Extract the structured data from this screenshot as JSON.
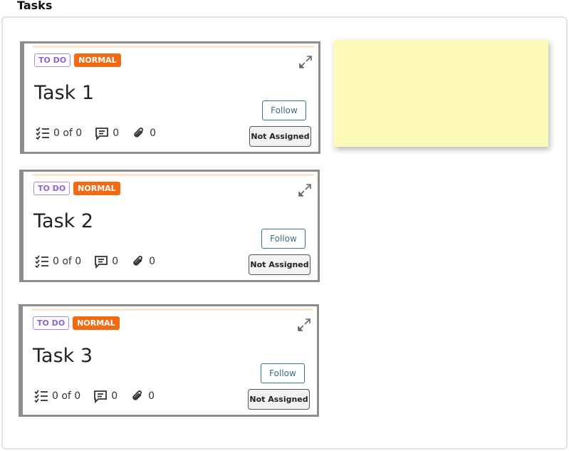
{
  "header": {
    "title": "Tasks"
  },
  "cards": [
    {
      "status": "TO DO",
      "priority": "NORMAL",
      "title": "Task 1",
      "checklist": "0 of 0",
      "comments": "0",
      "attachments": "0",
      "follow_label": "Follow",
      "assign_label": "Not Assigned"
    },
    {
      "status": "TO DO",
      "priority": "NORMAL",
      "title": "Task 2",
      "checklist": "0 of 0",
      "comments": "0",
      "attachments": "0",
      "follow_label": "Follow",
      "assign_label": "Not Assigned"
    },
    {
      "status": "TO DO",
      "priority": "NORMAL",
      "title": "Task 3",
      "checklist": "0 of 0",
      "comments": "0",
      "attachments": "0",
      "follow_label": "Follow",
      "assign_label": "Not Assigned"
    }
  ],
  "icons": {
    "expand": "expand-arrows-icon",
    "checklist": "checklist-icon",
    "comment": "comment-icon",
    "attachment": "paperclip-icon"
  },
  "colors": {
    "status_badge": "#8e63d6",
    "priority_badge": "#f26a12",
    "follow_button": "#3b6e84",
    "sticky_note": "#fefbb8",
    "card_border": "#8d8d8d"
  }
}
